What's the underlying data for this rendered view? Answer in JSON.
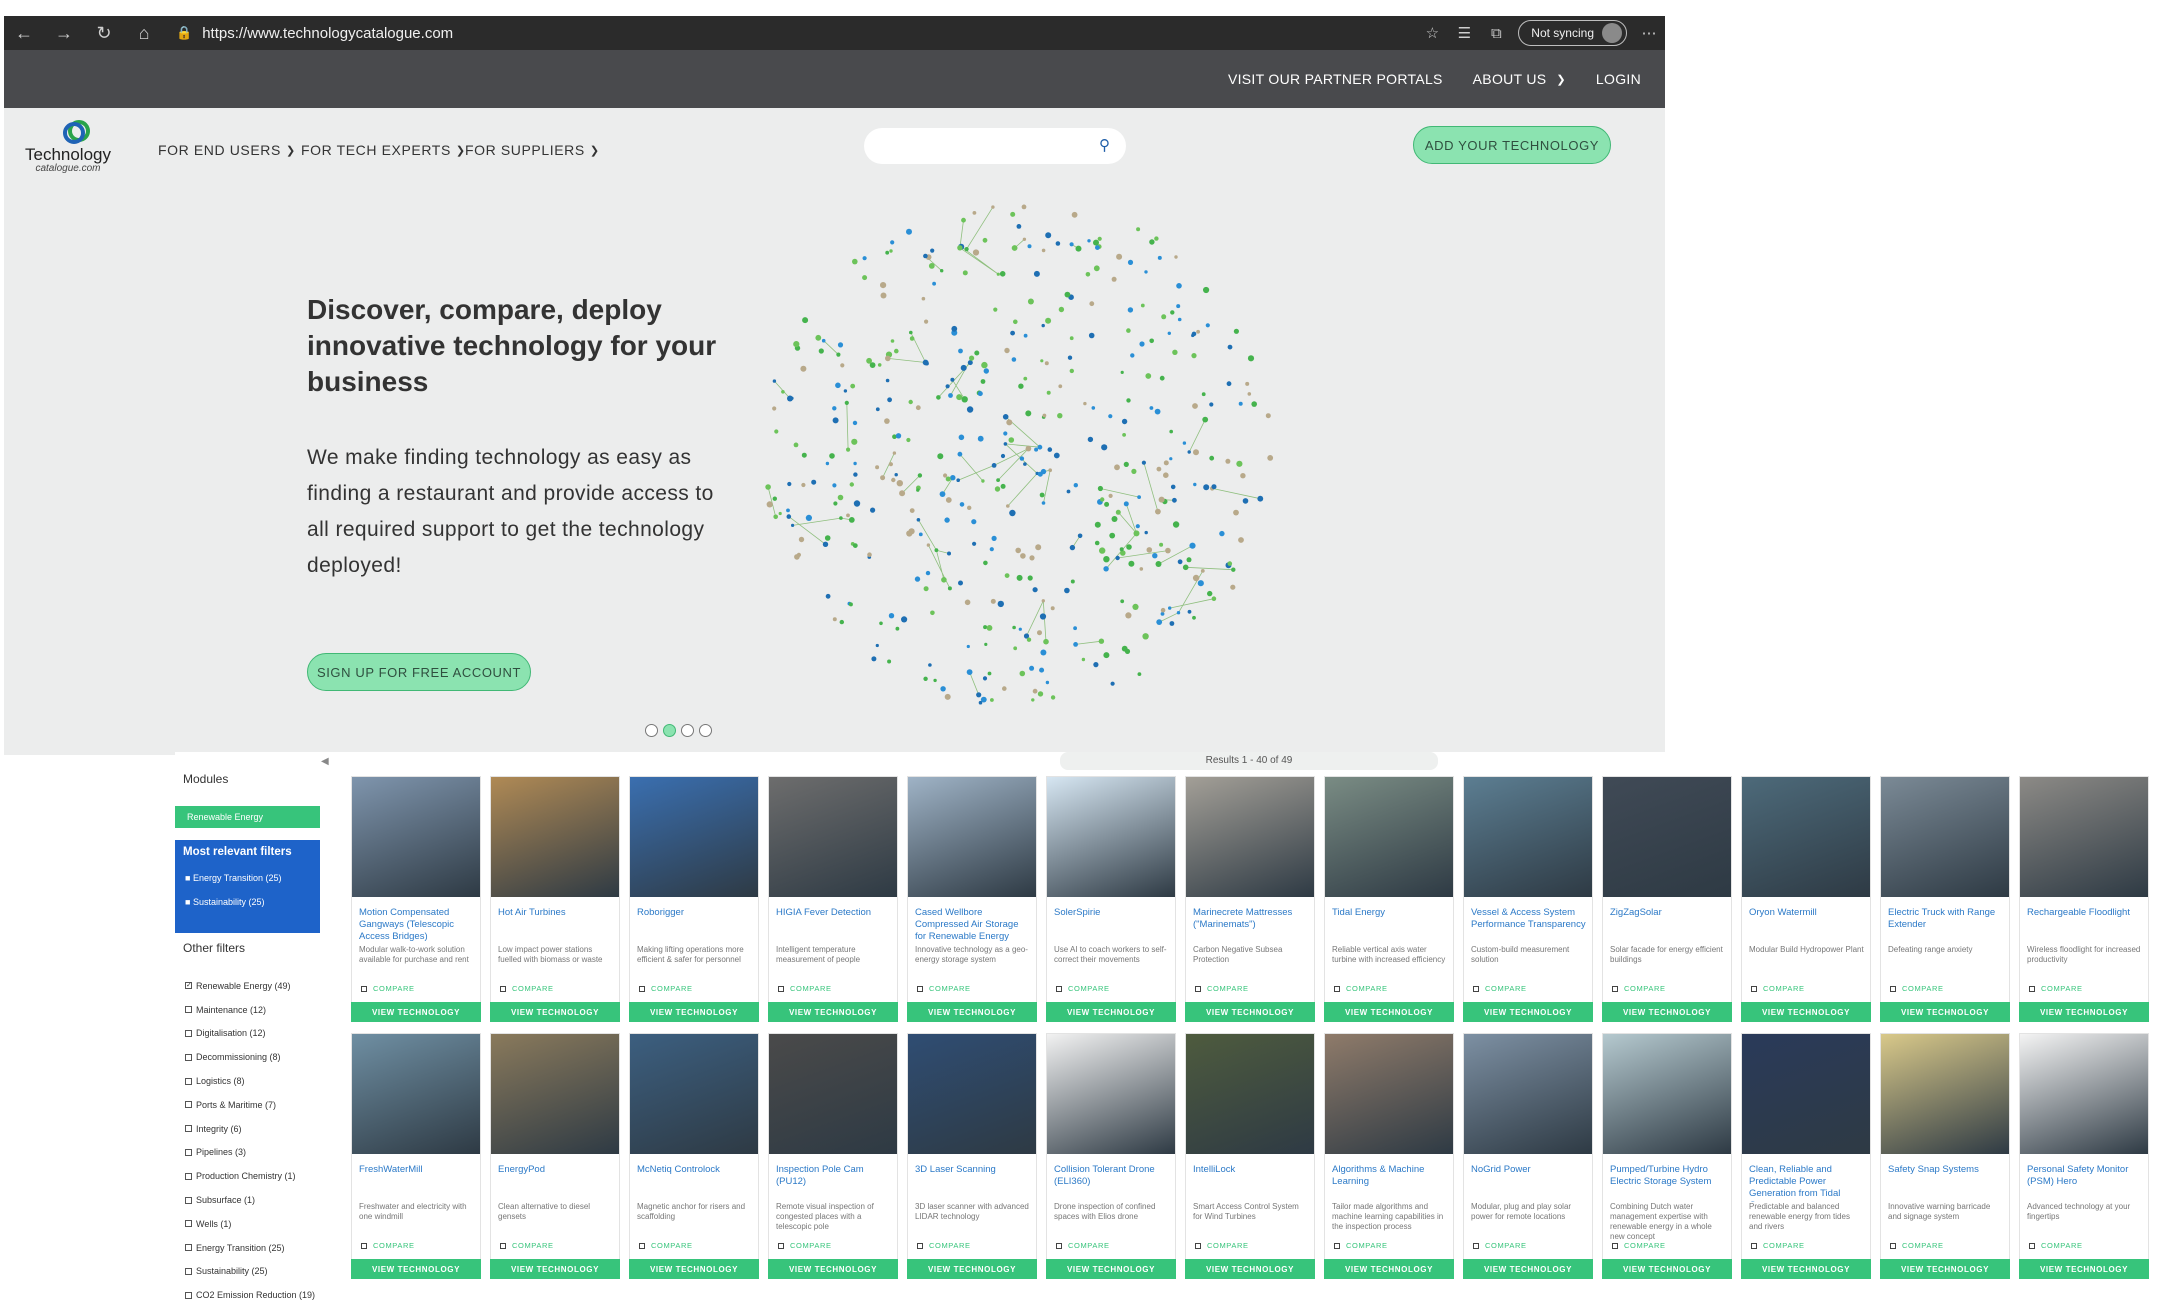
{
  "browser": {
    "url": "https://www.technologycatalogue.com",
    "sync_label": "Not syncing"
  },
  "topbar": {
    "partner": "VISIT OUR PARTNER PORTALS",
    "about": "ABOUT US",
    "login": "LOGIN"
  },
  "logo": {
    "name": "Technology",
    "tagline": "catalogue.com"
  },
  "nav": {
    "end_users": "FOR END USERS",
    "tech_experts": "FOR TECH EXPERTS",
    "suppliers": "FOR SUPPLIERS",
    "add_tech": "ADD YOUR TECHNOLOGY"
  },
  "hero": {
    "title": "Discover, compare, deploy innovative technology for your business",
    "subtitle": "We make finding technology as easy as finding a restaurant and provide access to all required support to get the technology deployed!",
    "signup": "SIGN UP FOR FREE ACCOUNT"
  },
  "catalog": {
    "results": "Results 1 - 40 of 49",
    "compare_label": "COMPARE",
    "view_label": "VIEW TECHNOLOGY"
  },
  "sidebar": {
    "modules_label": "Modules",
    "module_selected": "Renewable Energy",
    "relevant_label": "Most relevant filters",
    "relevant": [
      "Energy Transition (25)",
      "Sustainability (25)"
    ],
    "other_label": "Other filters",
    "filters": [
      {
        "label": "Renewable Energy (49)",
        "checked": true
      },
      {
        "label": "Maintenance (12)",
        "checked": false
      },
      {
        "label": "Digitalisation (12)",
        "checked": false
      },
      {
        "label": "Decommissioning (8)",
        "checked": false
      },
      {
        "label": "Logistics (8)",
        "checked": false
      },
      {
        "label": "Ports & Maritime (7)",
        "checked": false
      },
      {
        "label": "Integrity (6)",
        "checked": false
      },
      {
        "label": "Pipelines (3)",
        "checked": false
      },
      {
        "label": "Production Chemistry (1)",
        "checked": false
      },
      {
        "label": "Subsurface (1)",
        "checked": false
      },
      {
        "label": "Wells (1)",
        "checked": false
      },
      {
        "label": "Energy Transition (25)",
        "checked": false
      },
      {
        "label": "Sustainability (25)",
        "checked": false
      },
      {
        "label": "CO2 Emission Reduction (19)",
        "checked": false
      }
    ]
  },
  "cards_row1": [
    {
      "title": "Motion Compensated Gangways (Telescopic Access Bridges)",
      "desc": "Modular walk-to-work solution available for purchase and rent",
      "color": "#7f95ad"
    },
    {
      "title": "Hot Air Turbines",
      "desc": "Low impact power stations fuelled with biomass or waste",
      "color": "#b08a55"
    },
    {
      "title": "Roborigger",
      "desc": "Making lifting operations more efficient & safer for personnel",
      "color": "#3a6fb0"
    },
    {
      "title": "HIGIA Fever Detection",
      "desc": "Intelligent temperature measurement of people",
      "color": "#6d6d6d"
    },
    {
      "title": "Cased Wellbore Compressed Air Storage for Renewable Energy",
      "desc": "Innovative technology as a geo-energy storage system",
      "color": "#9fb3c6"
    },
    {
      "title": "SolerSpirie",
      "desc": "Use AI to coach workers to self-correct their movements",
      "color": "#d6e6f2"
    },
    {
      "title": "Marinecrete Mattresses (\"Marinemats\")",
      "desc": "Carbon Negative Subsea Protection",
      "color": "#a39f97"
    },
    {
      "title": "Tidal Energy",
      "desc": "Reliable vertical axis water turbine with increased efficiency",
      "color": "#7a8c84"
    },
    {
      "title": "Vessel & Access System Performance Transparency",
      "desc": "Custom-build measurement solution",
      "color": "#5c7e92"
    },
    {
      "title": "ZigZagSolar",
      "desc": "Solar facade for energy efficient buildings",
      "color": "#404a56"
    },
    {
      "title": "Oryon Watermill",
      "desc": "Modular Build Hydropower Plant",
      "color": "#4d6a7a"
    },
    {
      "title": "Electric Truck with Range Extender",
      "desc": "Defeating range anxiety",
      "color": "#7b8a96"
    },
    {
      "title": "Rechargeable Floodlight",
      "desc": "Wireless floodlight for increased productivity",
      "color": "#8c8a86"
    }
  ],
  "cards_row2": [
    {
      "title": "FreshWaterMill",
      "desc": "Freshwater and electricity with one windmill",
      "color": "#6f8fa3"
    },
    {
      "title": "EnergyPod",
      "desc": "Clean alternative to diesel gensets",
      "color": "#8a7a5c"
    },
    {
      "title": "McNetiq Controlock",
      "desc": "Magnetic anchor for risers and scaffolding",
      "color": "#3c5f80"
    },
    {
      "title": "Inspection Pole Cam (PU12)",
      "desc": "Remote visual inspection of congested places with a telescopic pole",
      "color": "#4a4a4a"
    },
    {
      "title": "3D Laser Scanning",
      "desc": "3D laser scanner with advanced LIDAR technology",
      "color": "#2f4d73"
    },
    {
      "title": "Collision Tolerant Drone (ELI360)",
      "desc": "Drone inspection of confined spaces with Elios drone",
      "color": "#f2f2f2"
    },
    {
      "title": "IntelliLock",
      "desc": "Smart Access Control System for Wind Turbines",
      "color": "#4e5b3e"
    },
    {
      "title": "Algorithms & Machine Learning",
      "desc": "Tailor made algorithms and machine learning capabilities in the inspection process",
      "color": "#8f7b6a"
    },
    {
      "title": "NoGrid Power",
      "desc": "Modular, plug and play solar power for remote locations",
      "color": "#7d90a3"
    },
    {
      "title": "Pumped/Turbine Hydro Electric Storage System",
      "desc": "Combining Dutch water management expertise with renewable energy in a whole new concept",
      "color": "#b5c9cf"
    },
    {
      "title": "Clean, Reliable and Predictable Power Generation from Tidal Currents",
      "desc": "Predictable and balanced renewable energy from tides and rivers",
      "color": "#2a3a5a"
    },
    {
      "title": "Safety Snap Systems",
      "desc": "Innovative warning barricade and signage system",
      "color": "#d9c98a"
    },
    {
      "title": "Personal Safety Monitor (PSM) Hero",
      "desc": "Advanced technology at your fingertips",
      "color": "#f4f4f4"
    }
  ]
}
